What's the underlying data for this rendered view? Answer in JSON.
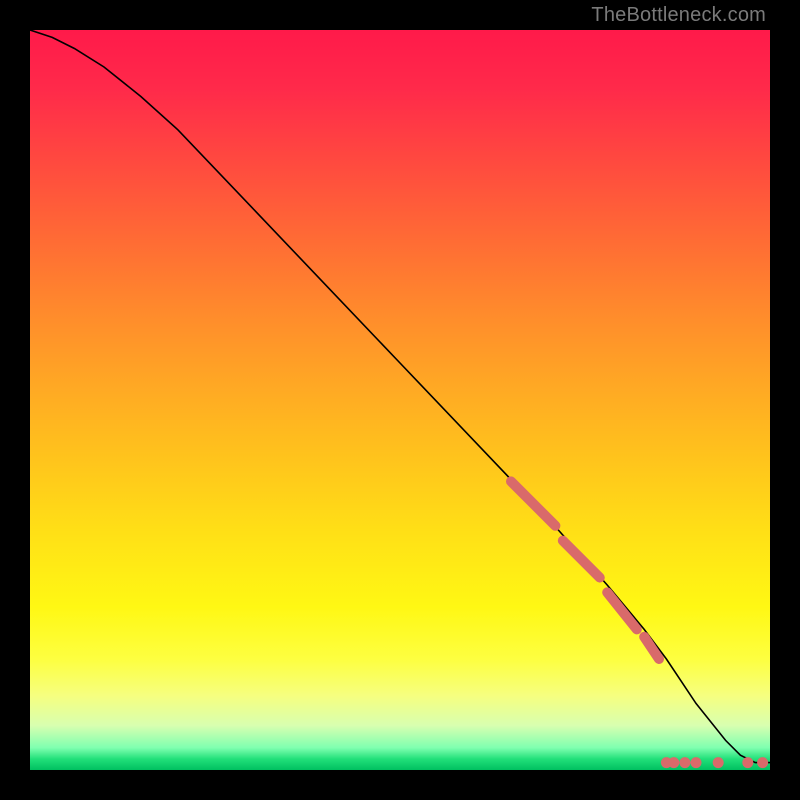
{
  "watermark": "TheBottleneck.com",
  "chart_data": {
    "type": "line",
    "title": "",
    "xlabel": "",
    "ylabel": "",
    "xlim": [
      0,
      100
    ],
    "ylim": [
      0,
      100
    ],
    "grid": false,
    "series": [
      {
        "name": "curve",
        "x": [
          0,
          3,
          6,
          10,
          15,
          20,
          30,
          40,
          50,
          60,
          70,
          78,
          83,
          86,
          88,
          90,
          92,
          94,
          96,
          98,
          100
        ],
        "values": [
          100,
          99,
          97.5,
          95,
          91,
          86.5,
          76,
          65.5,
          55,
          44.5,
          34,
          25,
          19,
          15,
          12,
          9,
          6.5,
          4,
          2,
          1,
          1
        ]
      }
    ],
    "highlight_segments": [
      {
        "x0": 65,
        "y0": 39,
        "x1": 71,
        "y1": 33
      },
      {
        "x0": 72,
        "y0": 31,
        "x1": 77,
        "y1": 26
      },
      {
        "x0": 78,
        "y0": 24,
        "x1": 82,
        "y1": 19
      },
      {
        "x0": 83,
        "y0": 18,
        "x1": 85,
        "y1": 15
      }
    ],
    "highlight_dots": [
      {
        "x": 86,
        "y": 1
      },
      {
        "x": 87,
        "y": 1
      },
      {
        "x": 88.5,
        "y": 1
      },
      {
        "x": 90,
        "y": 1
      },
      {
        "x": 93,
        "y": 1
      },
      {
        "x": 97,
        "y": 1
      },
      {
        "x": 99,
        "y": 1
      }
    ]
  }
}
